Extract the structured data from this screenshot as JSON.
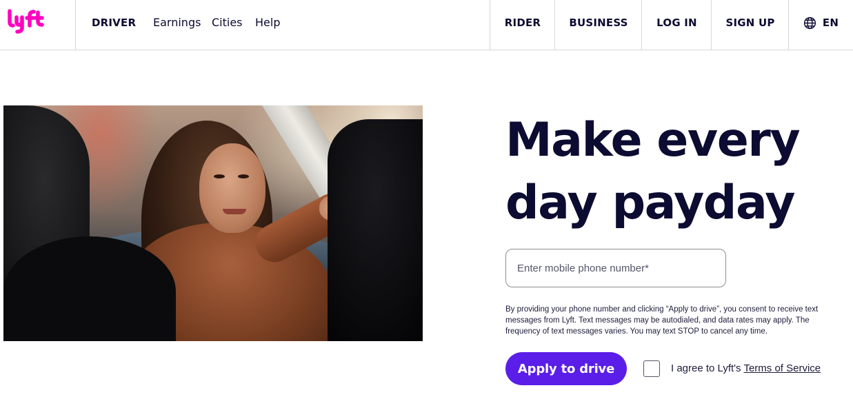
{
  "header": {
    "brand": "lyft",
    "brand_color": "#ff00bf",
    "nav_left": {
      "driver": "DRIVER",
      "earnings": "Earnings",
      "cities": "Cities",
      "help": "Help"
    },
    "nav_right": {
      "rider": "RIDER",
      "business": "BUSINESS",
      "login": "LOG IN",
      "signup": "SIGN UP",
      "language": "EN"
    },
    "language_icon": "globe-icon"
  },
  "hero": {
    "headline_line1": "Make every",
    "headline_line2": "day payday",
    "phone_placeholder": "Enter mobile phone number*",
    "disclaimer": "By providing your phone number and clicking “Apply to drive”, you consent to receive text messages from Lyft. Text messages may be autodialed, and data rates may apply. The frequency of text messages varies. You may text STOP to cancel any time.",
    "apply_label": "Apply to drive",
    "apply_color": "#5a1ee8",
    "agree_prefix": "I agree to Lyft's ",
    "tos_link": "Terms of Service",
    "agree_checked": false
  },
  "colors": {
    "text": "#0c0b31",
    "divider": "#d8d8dc"
  }
}
